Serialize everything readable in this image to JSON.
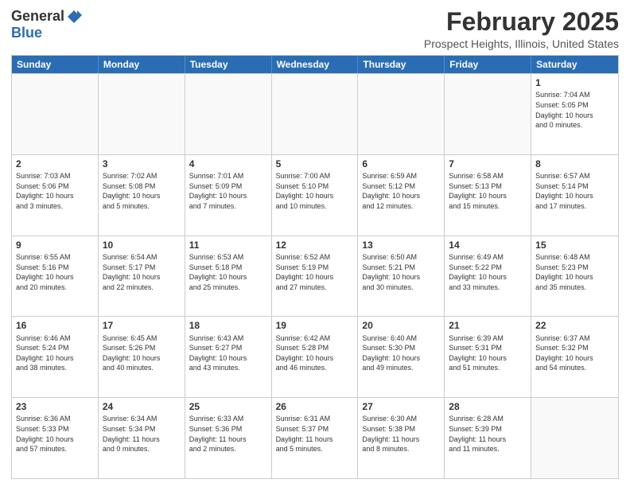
{
  "header": {
    "logo_general": "General",
    "logo_blue": "Blue",
    "month_title": "February 2025",
    "location": "Prospect Heights, Illinois, United States"
  },
  "weekdays": [
    "Sunday",
    "Monday",
    "Tuesday",
    "Wednesday",
    "Thursday",
    "Friday",
    "Saturday"
  ],
  "rows": [
    [
      {
        "day": "",
        "info": ""
      },
      {
        "day": "",
        "info": ""
      },
      {
        "day": "",
        "info": ""
      },
      {
        "day": "",
        "info": ""
      },
      {
        "day": "",
        "info": ""
      },
      {
        "day": "",
        "info": ""
      },
      {
        "day": "1",
        "info": "Sunrise: 7:04 AM\nSunset: 5:05 PM\nDaylight: 10 hours\nand 0 minutes."
      }
    ],
    [
      {
        "day": "2",
        "info": "Sunrise: 7:03 AM\nSunset: 5:06 PM\nDaylight: 10 hours\nand 3 minutes."
      },
      {
        "day": "3",
        "info": "Sunrise: 7:02 AM\nSunset: 5:08 PM\nDaylight: 10 hours\nand 5 minutes."
      },
      {
        "day": "4",
        "info": "Sunrise: 7:01 AM\nSunset: 5:09 PM\nDaylight: 10 hours\nand 7 minutes."
      },
      {
        "day": "5",
        "info": "Sunrise: 7:00 AM\nSunset: 5:10 PM\nDaylight: 10 hours\nand 10 minutes."
      },
      {
        "day": "6",
        "info": "Sunrise: 6:59 AM\nSunset: 5:12 PM\nDaylight: 10 hours\nand 12 minutes."
      },
      {
        "day": "7",
        "info": "Sunrise: 6:58 AM\nSunset: 5:13 PM\nDaylight: 10 hours\nand 15 minutes."
      },
      {
        "day": "8",
        "info": "Sunrise: 6:57 AM\nSunset: 5:14 PM\nDaylight: 10 hours\nand 17 minutes."
      }
    ],
    [
      {
        "day": "9",
        "info": "Sunrise: 6:55 AM\nSunset: 5:16 PM\nDaylight: 10 hours\nand 20 minutes."
      },
      {
        "day": "10",
        "info": "Sunrise: 6:54 AM\nSunset: 5:17 PM\nDaylight: 10 hours\nand 22 minutes."
      },
      {
        "day": "11",
        "info": "Sunrise: 6:53 AM\nSunset: 5:18 PM\nDaylight: 10 hours\nand 25 minutes."
      },
      {
        "day": "12",
        "info": "Sunrise: 6:52 AM\nSunset: 5:19 PM\nDaylight: 10 hours\nand 27 minutes."
      },
      {
        "day": "13",
        "info": "Sunrise: 6:50 AM\nSunset: 5:21 PM\nDaylight: 10 hours\nand 30 minutes."
      },
      {
        "day": "14",
        "info": "Sunrise: 6:49 AM\nSunset: 5:22 PM\nDaylight: 10 hours\nand 33 minutes."
      },
      {
        "day": "15",
        "info": "Sunrise: 6:48 AM\nSunset: 5:23 PM\nDaylight: 10 hours\nand 35 minutes."
      }
    ],
    [
      {
        "day": "16",
        "info": "Sunrise: 6:46 AM\nSunset: 5:24 PM\nDaylight: 10 hours\nand 38 minutes."
      },
      {
        "day": "17",
        "info": "Sunrise: 6:45 AM\nSunset: 5:26 PM\nDaylight: 10 hours\nand 40 minutes."
      },
      {
        "day": "18",
        "info": "Sunrise: 6:43 AM\nSunset: 5:27 PM\nDaylight: 10 hours\nand 43 minutes."
      },
      {
        "day": "19",
        "info": "Sunrise: 6:42 AM\nSunset: 5:28 PM\nDaylight: 10 hours\nand 46 minutes."
      },
      {
        "day": "20",
        "info": "Sunrise: 6:40 AM\nSunset: 5:30 PM\nDaylight: 10 hours\nand 49 minutes."
      },
      {
        "day": "21",
        "info": "Sunrise: 6:39 AM\nSunset: 5:31 PM\nDaylight: 10 hours\nand 51 minutes."
      },
      {
        "day": "22",
        "info": "Sunrise: 6:37 AM\nSunset: 5:32 PM\nDaylight: 10 hours\nand 54 minutes."
      }
    ],
    [
      {
        "day": "23",
        "info": "Sunrise: 6:36 AM\nSunset: 5:33 PM\nDaylight: 10 hours\nand 57 minutes."
      },
      {
        "day": "24",
        "info": "Sunrise: 6:34 AM\nSunset: 5:34 PM\nDaylight: 11 hours\nand 0 minutes."
      },
      {
        "day": "25",
        "info": "Sunrise: 6:33 AM\nSunset: 5:36 PM\nDaylight: 11 hours\nand 2 minutes."
      },
      {
        "day": "26",
        "info": "Sunrise: 6:31 AM\nSunset: 5:37 PM\nDaylight: 11 hours\nand 5 minutes."
      },
      {
        "day": "27",
        "info": "Sunrise: 6:30 AM\nSunset: 5:38 PM\nDaylight: 11 hours\nand 8 minutes."
      },
      {
        "day": "28",
        "info": "Sunrise: 6:28 AM\nSunset: 5:39 PM\nDaylight: 11 hours\nand 11 minutes."
      },
      {
        "day": "",
        "info": ""
      }
    ]
  ]
}
